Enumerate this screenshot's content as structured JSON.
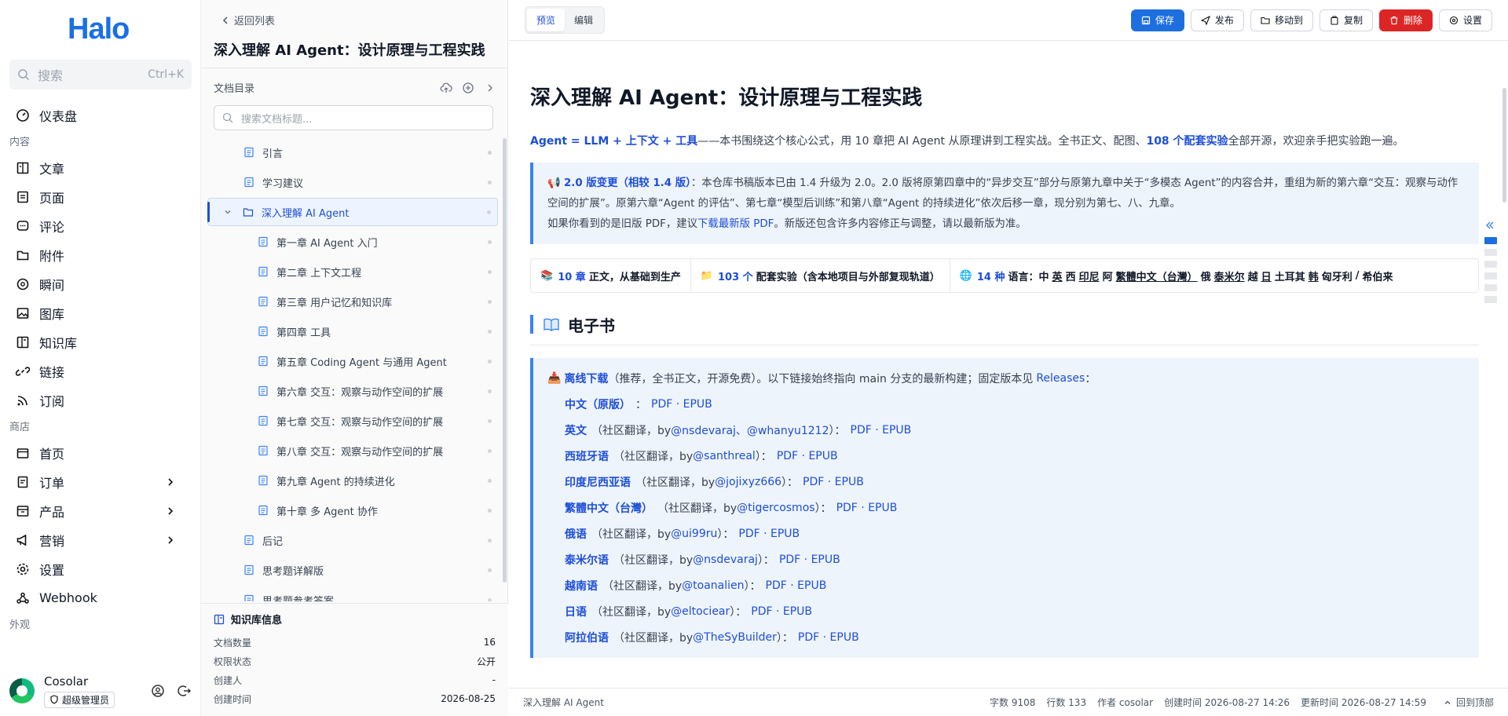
{
  "sidebar": {
    "logo": "Halo",
    "search": {
      "placeholder": "搜索",
      "shortcut": "Ctrl+K"
    },
    "dashboard": "仪表盘",
    "group_content": "内容",
    "content_items": [
      {
        "label": "文章",
        "icon": "document-icon"
      },
      {
        "label": "页面",
        "icon": "page-icon"
      },
      {
        "label": "评论",
        "icon": "comment-icon"
      },
      {
        "label": "附件",
        "icon": "folder-icon"
      },
      {
        "label": "瞬间",
        "icon": "moment-icon"
      },
      {
        "label": "图库",
        "icon": "gallery-icon"
      },
      {
        "label": "知识库",
        "icon": "book-icon"
      },
      {
        "label": "链接",
        "icon": "link-icon"
      },
      {
        "label": "订阅",
        "icon": "rss-icon"
      }
    ],
    "group_shop": "商店",
    "shop_items": [
      {
        "label": "首页",
        "icon": "shop-icon"
      },
      {
        "label": "订单",
        "icon": "order-icon"
      },
      {
        "label": "产品",
        "icon": "product-icon"
      },
      {
        "label": "营销",
        "icon": "megaphone-icon"
      }
    ],
    "settings": "设置",
    "webhook": "Webhook",
    "group_appearance": "外观",
    "user": {
      "name": "Cosolar",
      "role": "超级管理员"
    }
  },
  "docpanel": {
    "back": "返回列表",
    "title": "深入理解 AI Agent：设计原理与工程实践",
    "toc_title": "文档目录",
    "toc_search_placeholder": "搜索文档标题...",
    "toc": [
      {
        "label": "引言"
      },
      {
        "label": "学习建议"
      },
      {
        "label": "深入理解 AI Agent"
      },
      {
        "label": "第一章 AI Agent 入门"
      },
      {
        "label": "第二章 上下文工程"
      },
      {
        "label": "第三章 用户记忆和知识库"
      },
      {
        "label": "第四章 工具"
      },
      {
        "label": "第五章 Coding Agent 与通用 Agent"
      },
      {
        "label": "第六章 交互：观察与动作空间的扩展"
      },
      {
        "label": "第七章 交互：观察与动作空间的扩展"
      },
      {
        "label": "第八章 交互：观察与动作空间的扩展"
      },
      {
        "label": "第九章 Agent 的持续进化"
      },
      {
        "label": "第十章 多 Agent 协作"
      },
      {
        "label": "后记"
      },
      {
        "label": "思考题详解版"
      },
      {
        "label": "思考题参考答案"
      }
    ],
    "kb": {
      "title": "知识库信息",
      "rows": [
        {
          "k": "文档数量",
          "v": "16"
        },
        {
          "k": "权限状态",
          "v": "公开"
        },
        {
          "k": "创建人",
          "v": "-"
        },
        {
          "k": "创建时间",
          "v": "2026-08-25"
        }
      ]
    }
  },
  "topbar": {
    "preview": "预览",
    "edit": "编辑",
    "save": "保存",
    "publish": "发布",
    "move": "移动到",
    "copy": "复制",
    "delete": "删除",
    "settings": "设置"
  },
  "article": {
    "h1": "深入理解 AI Agent：设计原理与工程实践",
    "intro": {
      "formula": "Agent = LLM + 上下文 + 工具",
      "text1": "——本书围绕这个核心公式，用 10 章把 AI Agent 从原理讲到工程实战。全书正文、配图、",
      "count": "108 个配套实验",
      "text2": "全部开源，欢迎亲手把实验跑一遍。"
    },
    "notice": {
      "title": "2.0 版变更（相较 1.4 版）",
      "p1": "：本仓库书稿版本已由 1.4 升级为 2.0。2.0 版将原第四章中的“异步交互”部分与原第九章中关于“多模态 Agent”的内容合并，重组为新的第六章“交互：观察与动作空间的扩展”。原第六章“Agent 的评估”、第七章“模型后训练”和第八章“Agent 的持续进化”依次后移一章，现分别为第七、八、九章。",
      "p2a": "如果你看到的是旧版 PDF，建议",
      "p2link": "下载最新版 PDF",
      "p2b": "。新版还包含许多内容修正与调整，请以最新版为准。"
    },
    "stats": {
      "s1": {
        "num": "10 章",
        "text": "正文，从基础到生产"
      },
      "s2": {
        "num": "103 个",
        "text": "配套实验（含本地项目与外部复现轨道）"
      },
      "s3": {
        "num": "14 种",
        "prefix": "语言：",
        "langs": [
          "中",
          "英",
          "西",
          "印尼",
          "阿",
          "繁體中文（台灣）",
          "俄",
          "泰米尔",
          "越",
          "日",
          "土耳其",
          "韩",
          "匈牙利",
          "/",
          "希伯来"
        ]
      }
    },
    "h2": "电子书",
    "ebook": {
      "head_link": "离线下载",
      "head_text": "（推荐，全书正文，开源免费）。以下链接始终指向 main 分支的最新构建；固定版本见",
      "releases": "Releases",
      "head_end": "：",
      "rows": [
        {
          "lang": "中文（原版）",
          "note": "",
          "user": "",
          "fmt": "PDF · EPUB"
        },
        {
          "lang": "英文",
          "note": "（社区翻译，by ",
          "user": "@nsdevaraj、@whanyu1212",
          "fmt": "PDF · EPUB"
        },
        {
          "lang": "西班牙语",
          "note": "（社区翻译，by ",
          "user": "@santhreal",
          "fmt": "PDF · EPUB"
        },
        {
          "lang": "印度尼西亚语",
          "note": "（社区翻译，by ",
          "user": "@jojixyz666",
          "fmt": "PDF · EPUB"
        },
        {
          "lang": "繁體中文（台灣）",
          "note": "（社区翻译，by ",
          "user": "@tigercosmos",
          "fmt": "PDF · EPUB"
        },
        {
          "lang": "俄语",
          "note": "（社区翻译，by ",
          "user": "@ui99ru",
          "fmt": "PDF · EPUB"
        },
        {
          "lang": "泰米尔语",
          "note": "（社区翻译，by ",
          "user": "@nsdevaraj",
          "fmt": "PDF · EPUB"
        },
        {
          "lang": "越南语",
          "note": "（社区翻译，by ",
          "user": "@toanalien",
          "fmt": "PDF · EPUB"
        },
        {
          "lang": "日语",
          "note": "（社区翻译，by ",
          "user": "@eltociear",
          "fmt": "PDF · EPUB"
        },
        {
          "lang": "阿拉伯语",
          "note": "（社区翻译，by ",
          "user": "@TheSyBuilder",
          "fmt": "PDF · EPUB"
        }
      ]
    }
  },
  "statusbar": {
    "doc": "深入理解 AI Agent",
    "words": "字数 9108",
    "lines": "行数 133",
    "author": "作者 cosolar",
    "created": "创建时间 2026-08-27 14:26",
    "updated": "更新时间 2026-08-27 14:59",
    "back_top": "回到顶部"
  },
  "colors": {
    "brand": "#1a6fe6",
    "primary": "#1d6fe0",
    "danger": "#dc2626",
    "link": "#1d4ed8"
  }
}
